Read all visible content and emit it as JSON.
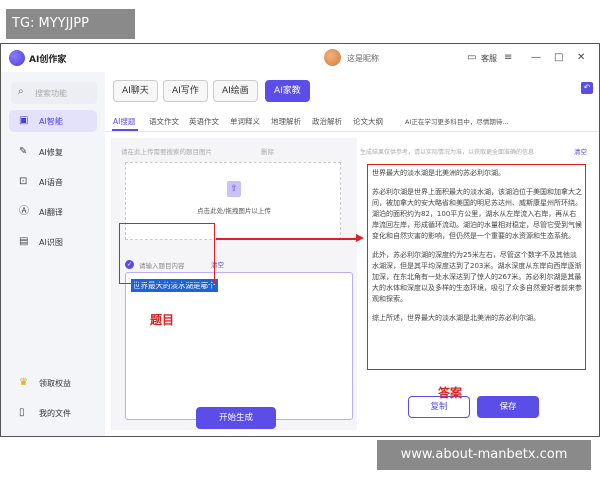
{
  "watermarks": {
    "top": "TG: MYYJJPP",
    "bottom": "www.about-manbetx.com"
  },
  "titlebar": {
    "app_name": "AI创作家",
    "username": "这是昵称",
    "service_label": "客服"
  },
  "sidebar": {
    "search_placeholder": "搜索功能",
    "items": [
      {
        "label": "AI智能",
        "icon": "chip-icon",
        "active": true
      },
      {
        "label": "AI修复",
        "icon": "repair-icon",
        "active": false
      },
      {
        "label": "AI语音",
        "icon": "voice-icon",
        "active": false
      },
      {
        "label": "AI翻译",
        "icon": "translate-icon",
        "active": false
      },
      {
        "label": "AI识图",
        "icon": "image-recognize-icon",
        "active": false
      }
    ],
    "bottom_items": [
      {
        "label": "领取权益",
        "icon": "crown-icon"
      },
      {
        "label": "我的文件",
        "icon": "file-icon"
      }
    ]
  },
  "main_tabs": [
    "AI聊天",
    "AI写作",
    "AI绘画",
    "AI家教"
  ],
  "active_main_tab": "AI家教",
  "subtabs": [
    "AI搜题",
    "语文作文",
    "英语作文",
    "单词释义",
    "地理解析",
    "政治解析",
    "论文大纲"
  ],
  "notice": "AI正在学习更多科目中，尽情期待...",
  "upload": {
    "header": "请在此上传需要搜索的题目图片",
    "delete": "删除",
    "hint": "点击此处/拖拽图片以上传"
  },
  "question": {
    "header": "请输入题目内容",
    "clear": "清空",
    "text": "世界最大的淡水湖是哪个"
  },
  "generate_button": "开始生成",
  "right": {
    "header": "生成结果仅供参考，请以实际情况为准，以获取更全面准确的信息",
    "clear": "清空",
    "paragraphs": [
      "世界最大的淡水湖是北美洲的苏必利尔湖。",
      "苏必利尔湖是世界上面积最大的淡水湖，该湖泊位于美国和加拿大之间，被加拿大的安大略省和美国的明尼苏达州、威斯康星州所环绕。湖泊的面积约为82，100平方公里，湖水从左岸流入右岸，再从右岸流回左岸，形成循环流动。湖泊的水量相对稳定，尽管它受到气候变化和自然灾害的影响，但仍然是一个重要的水资源和生态系统。",
      "此外，苏必利尔湖的深度约为25米左右，尽管这个数字不及其他淡水湖深，但是其平均深度达到了203米。湖水深度从东岸向西岸逐渐加深，在东北角有一处水深达到了惊人的267米。苏必利尔湖是其最大的水体和深度以及多样的生态环境，吸引了众多自然爱好者前来参观和探索。",
      "综上所述，世界最大的淡水湖是北美洲的苏必利尔湖。"
    ]
  },
  "copy_button": "复制",
  "save_button": "保存",
  "annotations": {
    "question": "题目",
    "answer": "答案"
  }
}
